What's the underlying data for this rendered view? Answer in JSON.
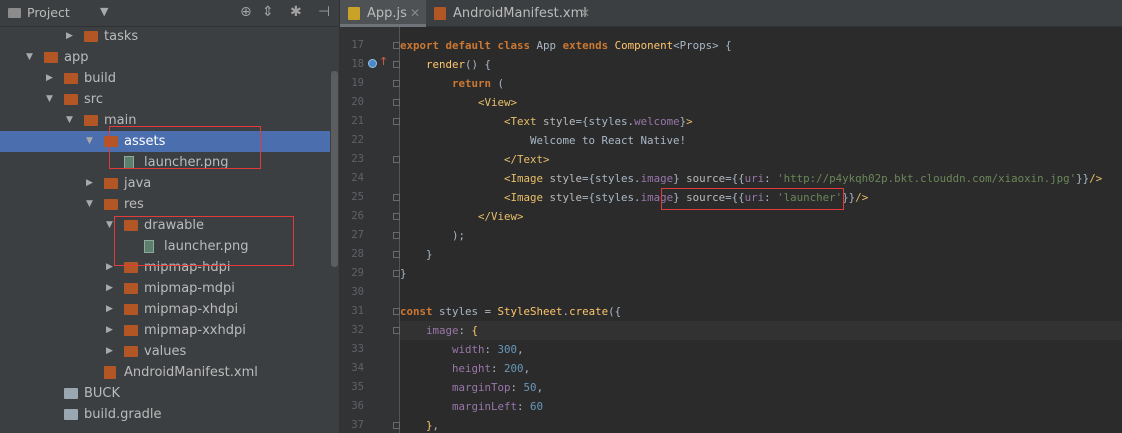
{
  "project_panel": {
    "title": "Project",
    "tree": [
      {
        "label": "tasks",
        "indent": 4,
        "arrow": "right",
        "icon": "folder"
      },
      {
        "label": "app",
        "indent": 2,
        "arrow": "down",
        "icon": "folder"
      },
      {
        "label": "build",
        "indent": 3,
        "arrow": "right",
        "icon": "folder"
      },
      {
        "label": "src",
        "indent": 3,
        "arrow": "down",
        "icon": "folder"
      },
      {
        "label": "main",
        "indent": 4,
        "arrow": "down",
        "icon": "folder"
      },
      {
        "label": "assets",
        "indent": 5,
        "arrow": "down",
        "icon": "folder",
        "selected": true
      },
      {
        "label": "launcher.png",
        "indent": 6,
        "arrow": "",
        "icon": "image"
      },
      {
        "label": "java",
        "indent": 5,
        "arrow": "right",
        "icon": "folder"
      },
      {
        "label": "res",
        "indent": 5,
        "arrow": "down",
        "icon": "folder"
      },
      {
        "label": "drawable",
        "indent": 6,
        "arrow": "down",
        "icon": "folder"
      },
      {
        "label": "launcher.png",
        "indent": 7,
        "arrow": "",
        "icon": "image"
      },
      {
        "label": "mipmap-hdpi",
        "indent": 6,
        "arrow": "right",
        "icon": "folder"
      },
      {
        "label": "mipmap-mdpi",
        "indent": 6,
        "arrow": "right",
        "icon": "folder"
      },
      {
        "label": "mipmap-xhdpi",
        "indent": 6,
        "arrow": "right",
        "icon": "folder"
      },
      {
        "label": "mipmap-xxhdpi",
        "indent": 6,
        "arrow": "right",
        "icon": "folder"
      },
      {
        "label": "values",
        "indent": 6,
        "arrow": "right",
        "icon": "folder"
      },
      {
        "label": "AndroidManifest.xml",
        "indent": 5,
        "arrow": "",
        "icon": "xml"
      },
      {
        "label": "BUCK",
        "indent": 3,
        "arrow": "",
        "icon": "file"
      },
      {
        "label": "build.gradle",
        "indent": 3,
        "arrow": "",
        "icon": "file"
      }
    ]
  },
  "tabs": [
    {
      "label": "App.js",
      "active": true,
      "icon_color": "#c9a227"
    },
    {
      "label": "AndroidManifest.xml",
      "active": false,
      "icon_color": "#b35626"
    }
  ],
  "editor": {
    "lines": [
      {
        "n": "17",
        "tokens": [
          [
            "kw",
            "export "
          ],
          [
            "kw",
            "default "
          ],
          [
            "kw",
            "class "
          ],
          [
            "txt",
            "App "
          ],
          [
            "kw",
            "extends "
          ],
          [
            "cls",
            "Component"
          ],
          [
            "txt",
            "<Props> {"
          ]
        ]
      },
      {
        "n": "18",
        "tokens": [
          [
            "txt",
            "    "
          ],
          [
            "fn",
            "render"
          ],
          [
            "txt",
            "() {"
          ]
        ]
      },
      {
        "n": "19",
        "tokens": [
          [
            "txt",
            "        "
          ],
          [
            "kw",
            "return "
          ],
          [
            "txt",
            "("
          ]
        ]
      },
      {
        "n": "20",
        "tokens": [
          [
            "txt",
            "            "
          ],
          [
            "tag",
            "<View>"
          ]
        ]
      },
      {
        "n": "21",
        "tokens": [
          [
            "txt",
            "                "
          ],
          [
            "tag",
            "<Text "
          ],
          [
            "attr",
            "style"
          ],
          [
            "txt",
            "={styles."
          ],
          [
            "prop",
            "welcome"
          ],
          [
            "txt",
            "}"
          ],
          [
            "tag",
            ">"
          ]
        ]
      },
      {
        "n": "22",
        "tokens": [
          [
            "txt",
            "                    Welcome to React Native!"
          ]
        ]
      },
      {
        "n": "23",
        "tokens": [
          [
            "txt",
            "                "
          ],
          [
            "tag",
            "</Text>"
          ]
        ]
      },
      {
        "n": "24",
        "tokens": [
          [
            "txt",
            "                "
          ],
          [
            "tag",
            "<Image "
          ],
          [
            "attr",
            "style"
          ],
          [
            "txt",
            "={styles."
          ],
          [
            "prop",
            "image"
          ],
          [
            "txt",
            "} "
          ],
          [
            "attr",
            "source"
          ],
          [
            "txt",
            "={{"
          ],
          [
            "prop",
            "uri"
          ],
          [
            "txt",
            ": "
          ],
          [
            "str",
            "'http://p4ykqh02p.bkt.clouddn.com/xiaoxin.jpg'"
          ],
          [
            "txt",
            "}}"
          ],
          [
            "tag",
            "/>"
          ]
        ]
      },
      {
        "n": "25",
        "tokens": [
          [
            "txt",
            "                "
          ],
          [
            "tag",
            "<Image "
          ],
          [
            "attr",
            "style"
          ],
          [
            "txt",
            "={styles."
          ],
          [
            "prop",
            "image"
          ],
          [
            "txt",
            "} "
          ],
          [
            "attr",
            "source"
          ],
          [
            "txt",
            "={{"
          ],
          [
            "prop",
            "uri"
          ],
          [
            "txt",
            ": "
          ],
          [
            "str",
            "'launcher'"
          ],
          [
            "txt",
            "}}"
          ],
          [
            "tag",
            "/>"
          ]
        ]
      },
      {
        "n": "26",
        "tokens": [
          [
            "txt",
            "            "
          ],
          [
            "tag",
            "</View>"
          ]
        ]
      },
      {
        "n": "27",
        "tokens": [
          [
            "txt",
            "        );"
          ]
        ]
      },
      {
        "n": "28",
        "tokens": [
          [
            "txt",
            "    }"
          ]
        ]
      },
      {
        "n": "29",
        "tokens": [
          [
            "txt",
            "}"
          ]
        ]
      },
      {
        "n": "30",
        "tokens": [
          [
            "txt",
            ""
          ]
        ]
      },
      {
        "n": "31",
        "tokens": [
          [
            "kw",
            "const "
          ],
          [
            "txt",
            "styles = "
          ],
          [
            "cls",
            "StyleSheet"
          ],
          [
            "txt",
            "."
          ],
          [
            "fn",
            "create"
          ],
          [
            "txt",
            "({"
          ]
        ]
      },
      {
        "n": "32",
        "tokens": [
          [
            "txt",
            "    "
          ],
          [
            "prop",
            "image"
          ],
          [
            "txt",
            ": "
          ],
          [
            "cls",
            "{"
          ]
        ]
      },
      {
        "n": "33",
        "tokens": [
          [
            "txt",
            "        "
          ],
          [
            "prop",
            "width"
          ],
          [
            "txt",
            ": "
          ],
          [
            "num",
            "300"
          ],
          [
            "txt",
            ","
          ]
        ]
      },
      {
        "n": "34",
        "tokens": [
          [
            "txt",
            "        "
          ],
          [
            "prop",
            "height"
          ],
          [
            "txt",
            ": "
          ],
          [
            "num",
            "200"
          ],
          [
            "txt",
            ","
          ]
        ]
      },
      {
        "n": "35",
        "tokens": [
          [
            "txt",
            "        "
          ],
          [
            "prop",
            "marginTop"
          ],
          [
            "txt",
            ": "
          ],
          [
            "num",
            "50"
          ],
          [
            "txt",
            ","
          ]
        ]
      },
      {
        "n": "36",
        "tokens": [
          [
            "txt",
            "        "
          ],
          [
            "prop",
            "marginLeft"
          ],
          [
            "txt",
            ": "
          ],
          [
            "num",
            "60"
          ]
        ]
      },
      {
        "n": "37",
        "tokens": [
          [
            "txt",
            "    "
          ],
          [
            "cls",
            "}"
          ],
          [
            "txt",
            ","
          ]
        ]
      }
    ]
  }
}
